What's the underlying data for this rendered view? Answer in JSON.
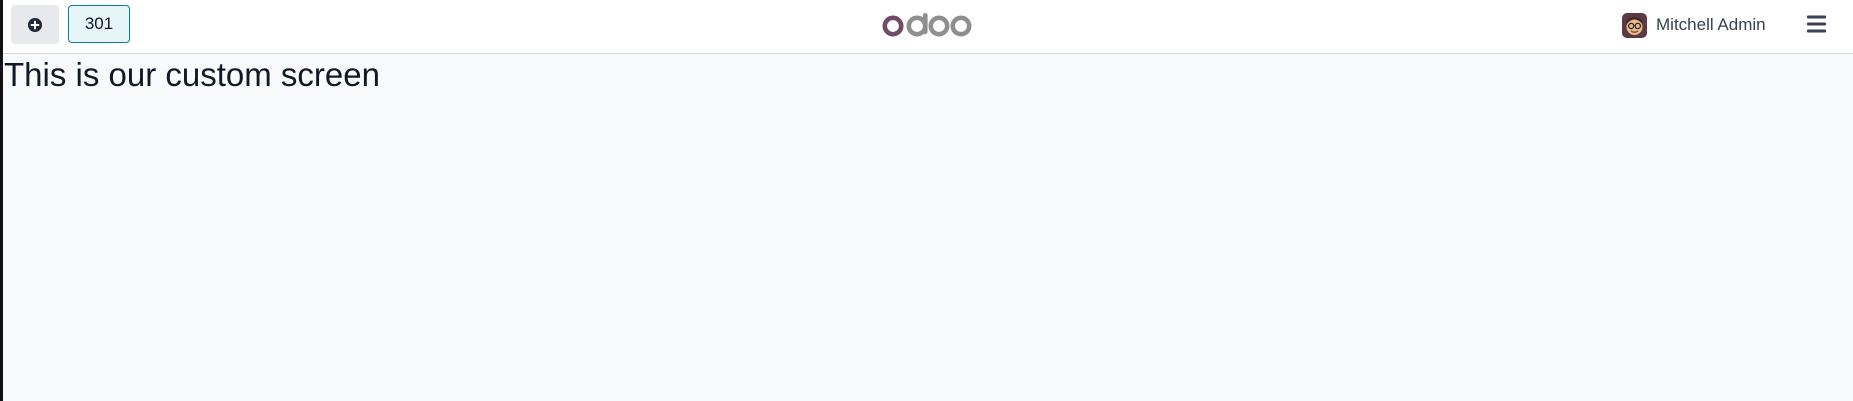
{
  "navbar": {
    "add_icon": "plus-circle-icon",
    "order_number": "301",
    "logo": {
      "text": "odoo",
      "colors": [
        "#714b67",
        "#8f8f8f",
        "#8f8f8f",
        "#8f8f8f"
      ]
    },
    "user": {
      "name": "Mitchell Admin",
      "avatar_icon": "avatar-icon"
    },
    "menu_icon": "hamburger-icon"
  },
  "content": {
    "text": "This is our custom screen"
  },
  "colors": {
    "background": "#f9fafb",
    "navbar": "#ffffff",
    "order_button_bg": "#e6f6f8",
    "order_button_border": "#0b7f99",
    "brand": "#714b67"
  }
}
